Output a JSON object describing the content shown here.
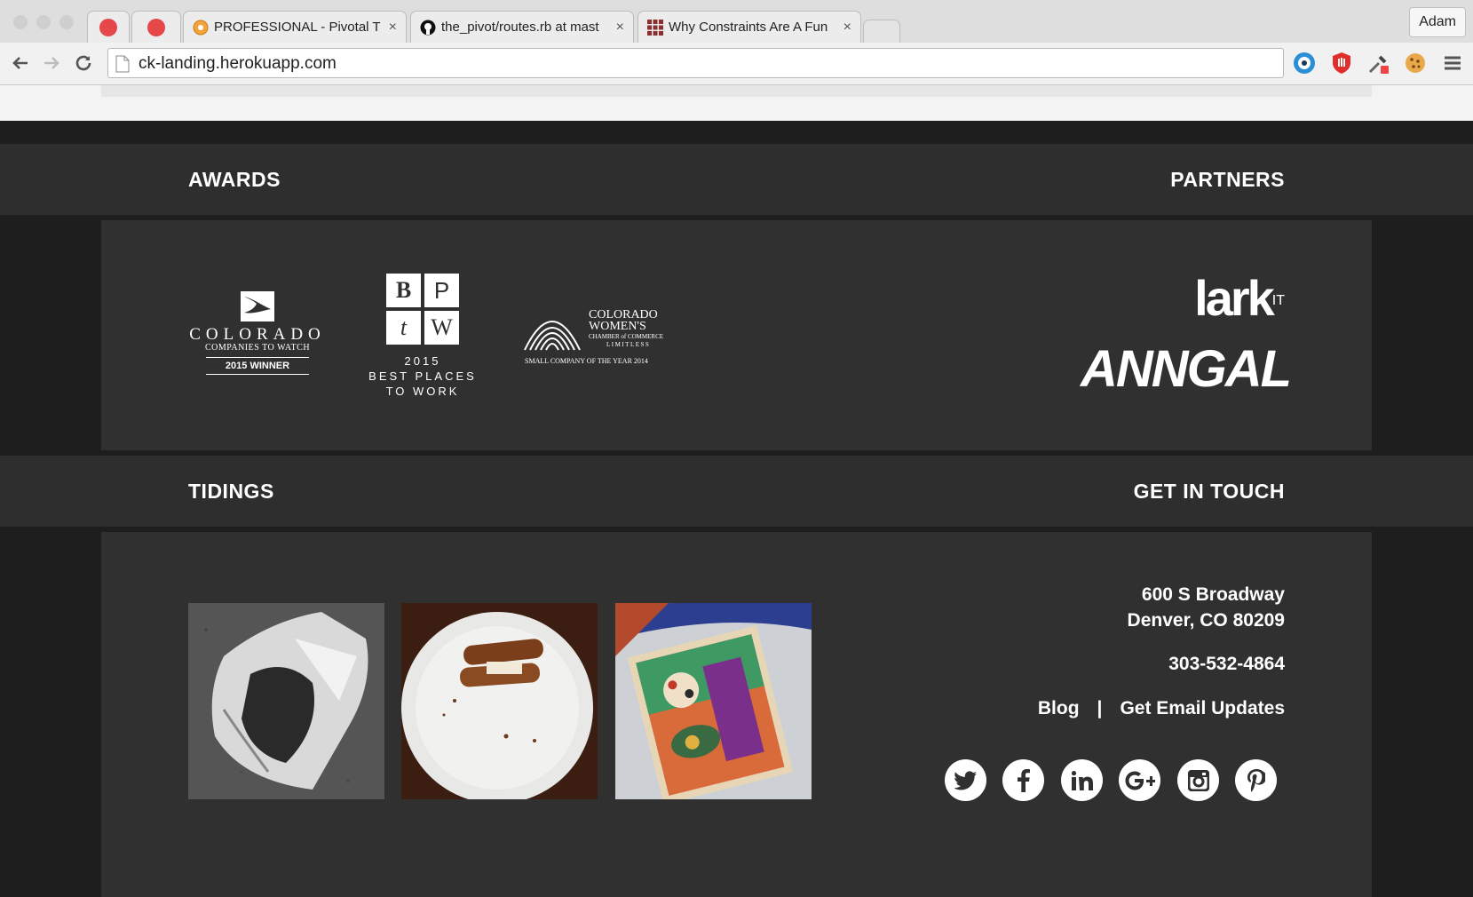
{
  "browser": {
    "tabs": [
      {
        "title": "",
        "icon": "record-icon"
      },
      {
        "title": "",
        "icon": "record-icon"
      },
      {
        "title": "PROFESSIONAL - Pivotal T",
        "icon": "pivotal-icon",
        "close": "×"
      },
      {
        "title": "the_pivot/routes.rb at mast",
        "icon": "github-icon",
        "close": "×"
      },
      {
        "title": "Why Constraints Are A Fun",
        "icon": "grid-icon",
        "close": "×"
      }
    ],
    "user": "Adam",
    "url": "ck-landing.herokuapp.com",
    "colors": {
      "record": "#e5474b"
    }
  },
  "sections": {
    "awards_heading": "AWARDS",
    "partners_heading": "PARTNERS",
    "tidings_heading": "TIDINGS",
    "contact_heading": "GET IN TOUCH"
  },
  "awards": {
    "colorado": {
      "name": "COLORADO",
      "sub": "COMPANIES TO WATCH",
      "winner": "2015 WINNER"
    },
    "bptw": {
      "letters": [
        "B",
        "P",
        "t",
        "W"
      ],
      "year": "2015",
      "line1": "BEST PLACES",
      "line2": "TO WORK"
    },
    "cwcc": {
      "line1": "COLORADO",
      "line2": "WOMEN'S",
      "line3": "CHAMBER of COMMERCE",
      "line4": "LIMITLESS",
      "caption": "SMALL COMPANY OF THE YEAR 2014"
    }
  },
  "partners": {
    "lark": "lark",
    "lark_sup": "IT",
    "annal": "ANNGAL"
  },
  "contact": {
    "address_line1": "600 S Broadway",
    "address_line2": "Denver, CO 80209",
    "phone": "303-532-4864",
    "blog": "Blog",
    "separator": "|",
    "updates": "Get Email Updates",
    "social": [
      "twitter-icon",
      "facebook-icon",
      "linkedin-icon",
      "google-plus-icon",
      "instagram-icon",
      "pinterest-icon"
    ]
  },
  "colors": {
    "page_bg": "#1e1e1e",
    "band_bg": "#2e2e2e",
    "panel_bg": "#303030",
    "text": "#ffffff"
  }
}
